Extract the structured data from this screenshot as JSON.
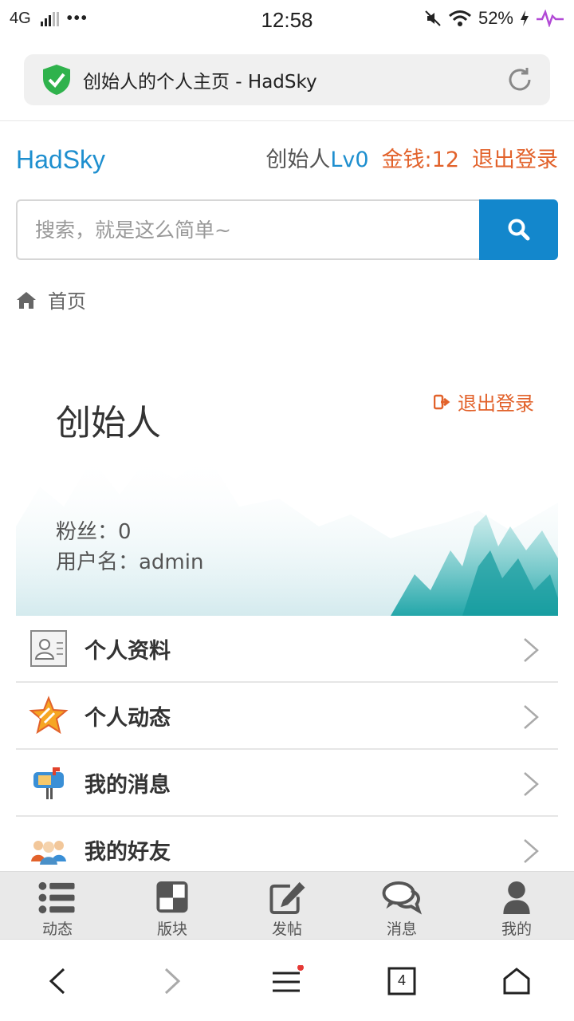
{
  "status_bar": {
    "network": "4G",
    "dots": "•••",
    "time": "12:58",
    "battery": "52%"
  },
  "browser": {
    "page_title": "创始人的个人主页 - HadSky",
    "tab_count": "4"
  },
  "header": {
    "logo": "HadSky",
    "username": "创始人",
    "level": "Lv0",
    "money": "金钱:12",
    "logout": "退出登录"
  },
  "search": {
    "placeholder": "搜索，就是这么简单~"
  },
  "breadcrumb": {
    "home": "首页"
  },
  "profile": {
    "name": "创始人",
    "logout": "退出登录",
    "fans": "粉丝：0",
    "username": "用户名：admin"
  },
  "menu": {
    "items": [
      {
        "label": "个人资料",
        "icon": "profile-card-icon"
      },
      {
        "label": "个人动态",
        "icon": "star-icon"
      },
      {
        "label": "我的消息",
        "icon": "mailbox-icon"
      },
      {
        "label": "我的好友",
        "icon": "friends-icon"
      }
    ]
  },
  "app_nav": {
    "items": [
      {
        "label": "动态",
        "icon": "list-icon"
      },
      {
        "label": "版块",
        "icon": "board-icon"
      },
      {
        "label": "发帖",
        "icon": "edit-icon"
      },
      {
        "label": "消息",
        "icon": "chat-icon"
      },
      {
        "label": "我的",
        "icon": "user-icon"
      }
    ]
  },
  "colors": {
    "brand_blue": "#1e8fcf",
    "search_button": "#1387cc",
    "accent_orange": "#e2622b"
  }
}
